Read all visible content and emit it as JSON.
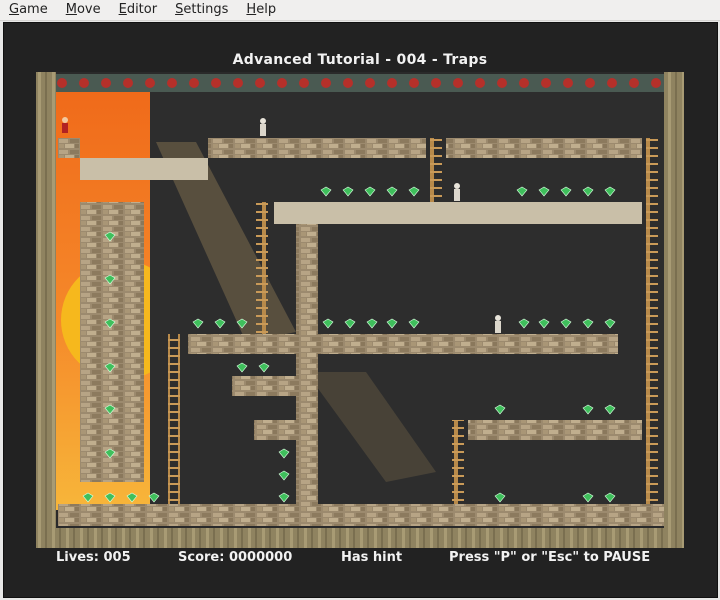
{
  "menu": {
    "items": [
      {
        "key": "game",
        "label": "Game",
        "mnemonic": "G",
        "rest": "ame"
      },
      {
        "key": "move",
        "label": "Move",
        "mnemonic": "M",
        "rest": "ove"
      },
      {
        "key": "editor",
        "label": "Editor",
        "mnemonic": "E",
        "rest": "ditor"
      },
      {
        "key": "settings",
        "label": "Settings",
        "mnemonic": "S",
        "rest": "ettings"
      },
      {
        "key": "help",
        "label": "Help",
        "mnemonic": "H",
        "rest": "elp"
      }
    ]
  },
  "level": {
    "title": "Advanced Tutorial - 004 - Traps"
  },
  "status": {
    "lives": "Lives: 005",
    "score": "Score: 0000000",
    "hint": "Has hint",
    "pause": "Press \"P\" or \"Esc\" to PAUSE"
  },
  "colors": {
    "background": "#222222",
    "brick": "#9c8a6e",
    "ladder": "#b88a4a",
    "gem": "#3fbf5c",
    "sunset": "#f07a1e"
  },
  "icons": {
    "hero": "hero-icon",
    "enemy": "skeleton-enemy-icon",
    "gem": "emerald-gem-icon"
  }
}
